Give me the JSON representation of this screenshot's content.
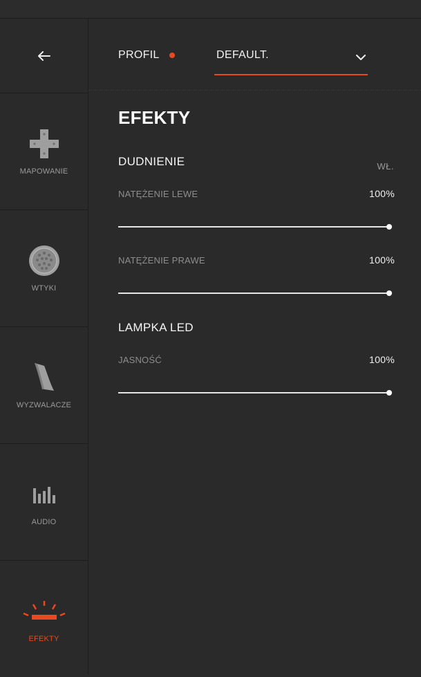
{
  "sidebar": {
    "back": {
      "icon": "arrow-left-icon"
    },
    "items": [
      {
        "label": "MAPOWANIE",
        "icon": "dpad-icon",
        "active": false
      },
      {
        "label": "WTYKI",
        "icon": "plug-icon",
        "active": false
      },
      {
        "label": "WYZWALACZE",
        "icon": "trigger-icon",
        "active": false
      },
      {
        "label": "AUDIO",
        "icon": "audio-bars-icon",
        "active": false
      },
      {
        "label": "EFEKTY",
        "icon": "light-effects-icon",
        "active": true
      }
    ]
  },
  "profile": {
    "label": "PROFIL",
    "selected": "DEFAULT.",
    "indicator_color": "#e8491f"
  },
  "main": {
    "title": "EFEKTY",
    "groups": [
      {
        "title": "DUDNIENIE",
        "state": "WŁ.",
        "rows": [
          {
            "label": "NATĘŻENIE LEWE",
            "value": "100%",
            "level": 1.0
          },
          {
            "label": "NATĘŻENIE PRAWE",
            "value": "100%",
            "level": 1.0
          }
        ]
      },
      {
        "title": "LAMPKA LED",
        "state": "",
        "rows": [
          {
            "label": "JASNOŚĆ",
            "value": "100%",
            "level": 1.0
          }
        ]
      }
    ]
  },
  "colors": {
    "accent": "#e8491f",
    "background": "#2a2a2a",
    "muted_text": "#8d8d8d"
  }
}
